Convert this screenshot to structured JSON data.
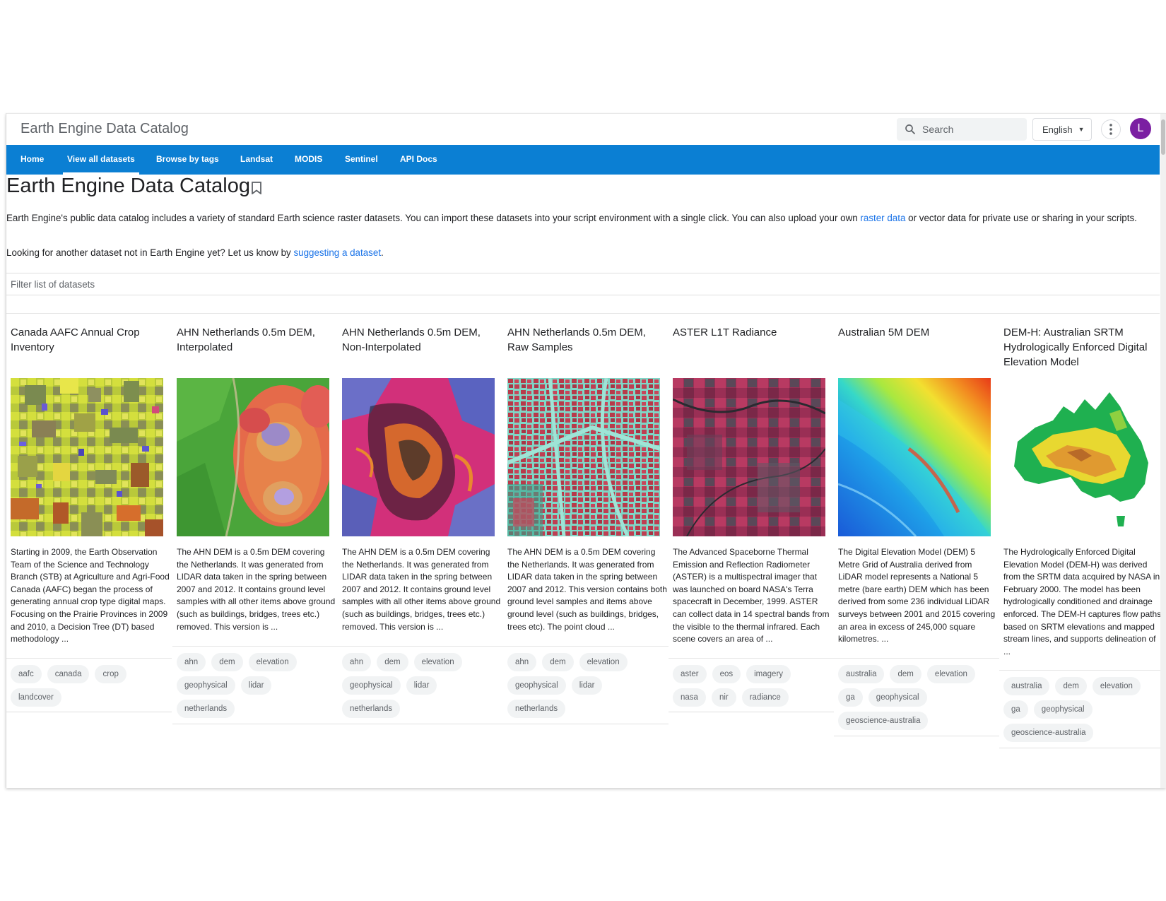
{
  "app": {
    "title": "Earth Engine Data Catalog"
  },
  "search": {
    "placeholder": "Search"
  },
  "language": {
    "selected": "English"
  },
  "user": {
    "avatar_letter": "L",
    "avatar_color": "#7b1fa2"
  },
  "nav": {
    "color": "#0b7fd3",
    "tabs": [
      {
        "label": "Home"
      },
      {
        "label": "View all datasets",
        "active": true
      },
      {
        "label": "Browse by tags"
      },
      {
        "label": "Landsat"
      },
      {
        "label": "MODIS"
      },
      {
        "label": "Sentinel"
      },
      {
        "label": "API Docs"
      }
    ]
  },
  "page": {
    "title": "Earth Engine Data Catalog",
    "intro_text_1": "Earth Engine's public data catalog includes a variety of standard Earth science raster datasets. You can import these datasets into your script environment with a single click. You can also upload your own ",
    "intro_link_1": "raster data",
    "intro_text_2": " or vector data for private use or sharing in your scripts.",
    "suggest_text": "Looking for another dataset not in Earth Engine yet? Let us know by ",
    "suggest_link": "suggesting a dataset",
    "suggest_end": ".",
    "filter_placeholder": "Filter list of datasets"
  },
  "datasets": [
    {
      "title": "Canada AAFC Annual Crop Inventory",
      "thumbnail": "crop-map",
      "description": "Starting in 2009, the Earth Observation Team of the Science and Technology Branch (STB) at Agriculture and Agri-Food Canada (AAFC) began the process of generating annual crop type digital maps. Focusing on the Prairie Provinces in 2009 and 2010, a Decision Tree (DT) based methodology ...",
      "tags": [
        "aafc",
        "canada",
        "crop",
        "landcover"
      ]
    },
    {
      "title": "AHN Netherlands 0.5m DEM, Interpolated",
      "thumbnail": "dem-interpolated",
      "description": "The AHN DEM is a 0.5m DEM covering the Netherlands. It was generated from LIDAR data taken in the spring between 2007 and 2012. It contains ground level samples with all other items above ground (such as buildings, bridges, trees etc.) removed. This version is ...",
      "tags": [
        "ahn",
        "dem",
        "elevation",
        "geophysical",
        "lidar",
        "netherlands"
      ]
    },
    {
      "title": "AHN Netherlands 0.5m DEM, Non-Interpolated",
      "thumbnail": "dem-non-interpolated",
      "description": "The AHN DEM is a 0.5m DEM covering the Netherlands. It was generated from LIDAR data taken in the spring between 2007 and 2012. It contains ground level samples with all other items above ground (such as buildings, bridges, trees etc.) removed. This version is ...",
      "tags": [
        "ahn",
        "dem",
        "elevation",
        "geophysical",
        "lidar",
        "netherlands"
      ]
    },
    {
      "title": "AHN Netherlands 0.5m DEM, Raw Samples",
      "thumbnail": "dem-raw-city",
      "description": "The AHN DEM is a 0.5m DEM covering the Netherlands. It was generated from LIDAR data taken in the spring between 2007 and 2012. This version contains both ground level samples and items above ground level (such as buildings, bridges, trees etc). The point cloud ...",
      "tags": [
        "ahn",
        "dem",
        "elevation",
        "geophysical",
        "lidar",
        "netherlands"
      ]
    },
    {
      "title": "ASTER L1T Radiance",
      "thumbnail": "aster-false-color",
      "description": "The Advanced Spaceborne Thermal Emission and Reflection Radiometer (ASTER) is a multispectral imager that was launched on board NASA's Terra spacecraft in December, 1999. ASTER can collect data in 14 spectral bands from the visible to the thermal infrared. Each scene covers an area of ...",
      "tags": [
        "aster",
        "eos",
        "imagery",
        "nasa",
        "nir",
        "radiance"
      ]
    },
    {
      "title": "Australian 5M DEM",
      "thumbnail": "australia-5m-dem",
      "description": "The Digital Elevation Model (DEM) 5 Metre Grid of Australia derived from LiDAR model represents a National 5 metre (bare earth) DEM which has been derived from some 236 individual LiDAR surveys between 2001 and 2015 covering an area in excess of 245,000 square kilometres. ...",
      "tags": [
        "australia",
        "dem",
        "elevation",
        "ga",
        "geophysical",
        "geoscience-australia"
      ]
    },
    {
      "title": "DEM-H: Australian SRTM Hydrologically Enforced Digital Elevation Model",
      "thumbnail": "australia-srtm-map",
      "description": "The Hydrologically Enforced Digital Elevation Model (DEM-H) was derived from the SRTM data acquired by NASA in February 2000. The model has been hydrologically conditioned and drainage enforced. The DEM-H captures flow paths based on SRTM elevations and mapped stream lines, and supports delineation of ...",
      "tags": [
        "australia",
        "dem",
        "elevation",
        "ga",
        "geophysical",
        "geoscience-australia"
      ]
    }
  ]
}
